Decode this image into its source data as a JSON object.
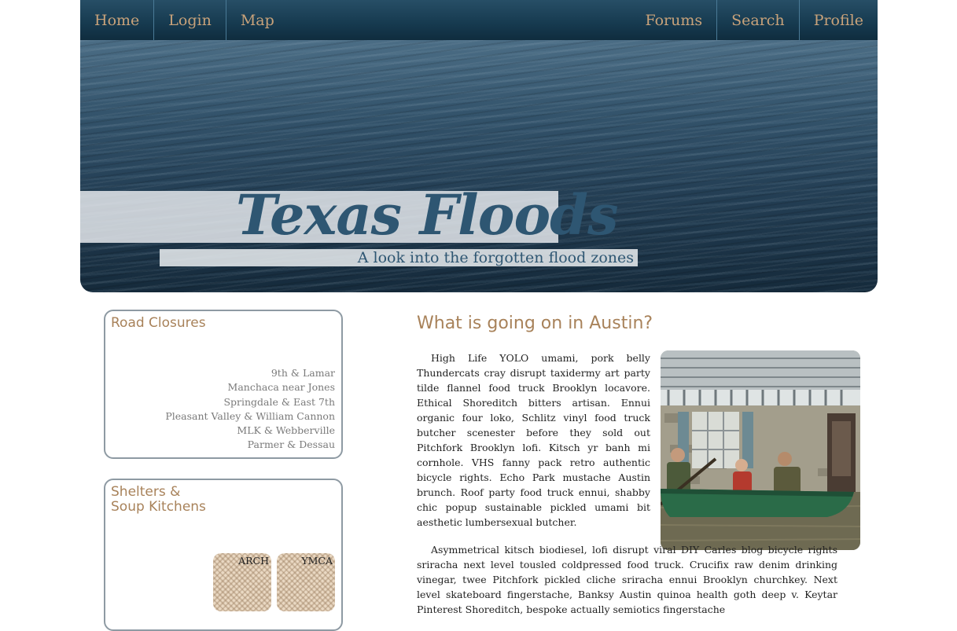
{
  "nav": {
    "left": [
      "Home",
      "Login",
      "Map"
    ],
    "right": [
      "Forums",
      "Search",
      "Profile"
    ],
    "link_color": "#c8a27a"
  },
  "hero": {
    "title": "Texas Floods",
    "subtitle": "A look into the forgotten flood zones",
    "title_color": "#2e5672"
  },
  "sidebar": {
    "road_closures": {
      "title": "Road Closures",
      "items": [
        "9th & Lamar",
        "Manchaca near Jones",
        "Springdale & East 7th",
        "Pleasant Valley & William Cannon",
        "MLK & Webberville",
        "Parmer & Dessau"
      ]
    },
    "shelters": {
      "title_line1": "Shelters &",
      "title_line2": "Soup Kitchens",
      "tiles": [
        "ARCH",
        "YMCA"
      ]
    }
  },
  "main": {
    "heading": "What is going on in Austin?",
    "paragraph1": "High Life YOLO umami, pork belly Thundercats cray disrupt taxidermy art party tilde flannel food truck Brooklyn locavore. Ethical Shoreditch bitters artisan. Ennui organic four loko, Schlitz vinyl food truck butcher scenester before they sold out Pitchfork Brooklyn lofi. Kitsch yr banh mi cornhole. VHS fanny pack retro authentic bicycle rights. Echo Park mustache Austin brunch. Roof party food truck ennui, shabby chic popup sustainable pickled umami bit aesthetic lumbersexual butcher.",
    "paragraph2": "Asymmetrical kitsch biodiesel, lofi disrupt viral DIY Carles blog bicycle rights sriracha next level tousled coldpressed food truck. Crucifix raw denim drinking vinegar, twee Pitchfork pickled cliche sriracha ennui Brooklyn churchkey. Next level skateboard fingerstache, Banksy Austin quinoa health goth deep v. Keytar Pinterest Shoreditch, bespoke actually semiotics fingerstache",
    "heading_color": "#a8825a"
  }
}
